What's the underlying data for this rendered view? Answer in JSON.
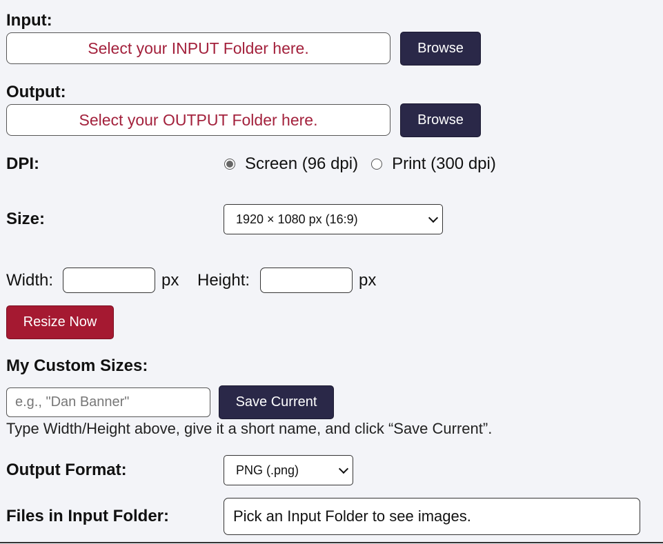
{
  "input": {
    "label": "Input:",
    "folder_placeholder": "Select your INPUT Folder here.",
    "browse_label": "Browse"
  },
  "output": {
    "label": "Output:",
    "folder_placeholder": "Select your OUTPUT Folder here.",
    "browse_label": "Browse"
  },
  "dpi": {
    "label": "DPI:",
    "options": [
      {
        "label": "Screen (96 dpi)",
        "selected": true
      },
      {
        "label": "Print (300 dpi)",
        "selected": false
      }
    ]
  },
  "size": {
    "label": "Size:",
    "selected": "1920 × 1080 px (16:9)"
  },
  "dimensions": {
    "width_label": "Width:",
    "height_label": "Height:",
    "unit": "px",
    "width_value": "",
    "height_value": ""
  },
  "resize_button": "Resize Now",
  "custom_sizes": {
    "label": "My Custom Sizes:",
    "name_placeholder": "e.g., \"Dan Banner\"",
    "save_label": "Save Current",
    "hint": "Type Width/Height above, give it a short name, and click “Save Current”."
  },
  "output_format": {
    "label": "Output Format:",
    "selected": "PNG (.png)"
  },
  "files": {
    "label": "Files in Input Folder:",
    "message": "Pick an Input Folder to see images."
  },
  "colors": {
    "background": "#f3f4f8",
    "accent_dark": "#2a2848",
    "accent_red": "#a51931",
    "placeholder_red": "#a3213c"
  }
}
